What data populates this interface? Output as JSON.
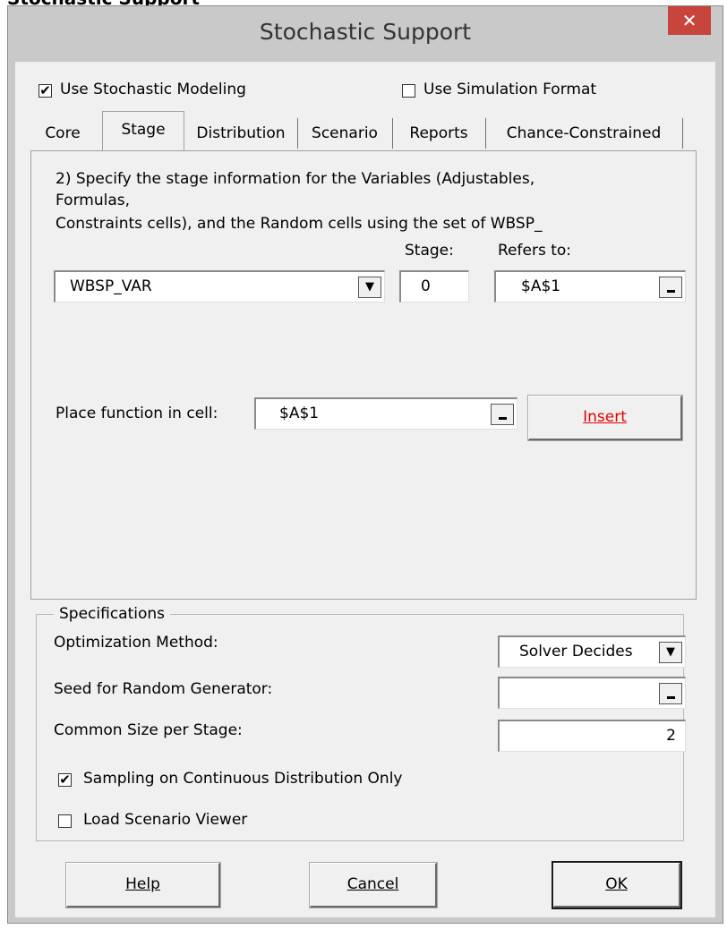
{
  "window": {
    "title": "Stochastic Support",
    "close_glyph": "✕"
  },
  "cropped_heading": "Stochastic Support",
  "top_options": {
    "use_stochastic_modeling": {
      "label": "Use Stochastic Modeling",
      "checked": true
    },
    "use_simulation_format": {
      "label": "Use Simulation Format",
      "checked": false
    }
  },
  "tabs": [
    {
      "label": "Core"
    },
    {
      "label": "Stage"
    },
    {
      "label": "Distribution"
    },
    {
      "label": "Scenario"
    },
    {
      "label": "Reports"
    },
    {
      "label": "Chance-Constrained"
    }
  ],
  "active_tab": "Stage",
  "stage_panel": {
    "instructions": [
      "2) Specify the stage information for the Variables (Adjustables,",
      "Formulas,",
      "Constraints cells), and the Random cells using the set of WBSP_"
    ],
    "stage_label": "Stage:",
    "refers_to_label": "Refers to:",
    "function_select": "WBSP_VAR",
    "stage_value": "0",
    "refers_to_value": "$A$1",
    "place_function_label": "Place function in cell:",
    "place_function_value": "$A$1",
    "insert_label": "Insert"
  },
  "specifications": {
    "legend": "Specifications",
    "optimization_method_label": "Optimization Method:",
    "optimization_method_value": "Solver Decides",
    "seed_label": "Seed for Random Generator:",
    "seed_value": "",
    "common_size_label": "Common Size per Stage:",
    "common_size_value": "2",
    "sampling_continuous": {
      "label": "Sampling on Continuous Distribution Only",
      "checked": true
    },
    "load_scenario_viewer": {
      "label": "Load Scenario Viewer",
      "checked": false
    }
  },
  "buttons": {
    "help": "Help",
    "cancel": "Cancel",
    "ok": "OK"
  },
  "colors": {
    "titlebar": "#c9c9c9",
    "close_button": "#c7453c",
    "dialog_bg": "#f0f0f0",
    "insert_text": "#e00000"
  },
  "icons": {
    "close": "close-icon",
    "dropdown": "chevron-down-icon",
    "range_picker": "collapse-dialog-icon",
    "checkmark": "checkmark-icon"
  }
}
